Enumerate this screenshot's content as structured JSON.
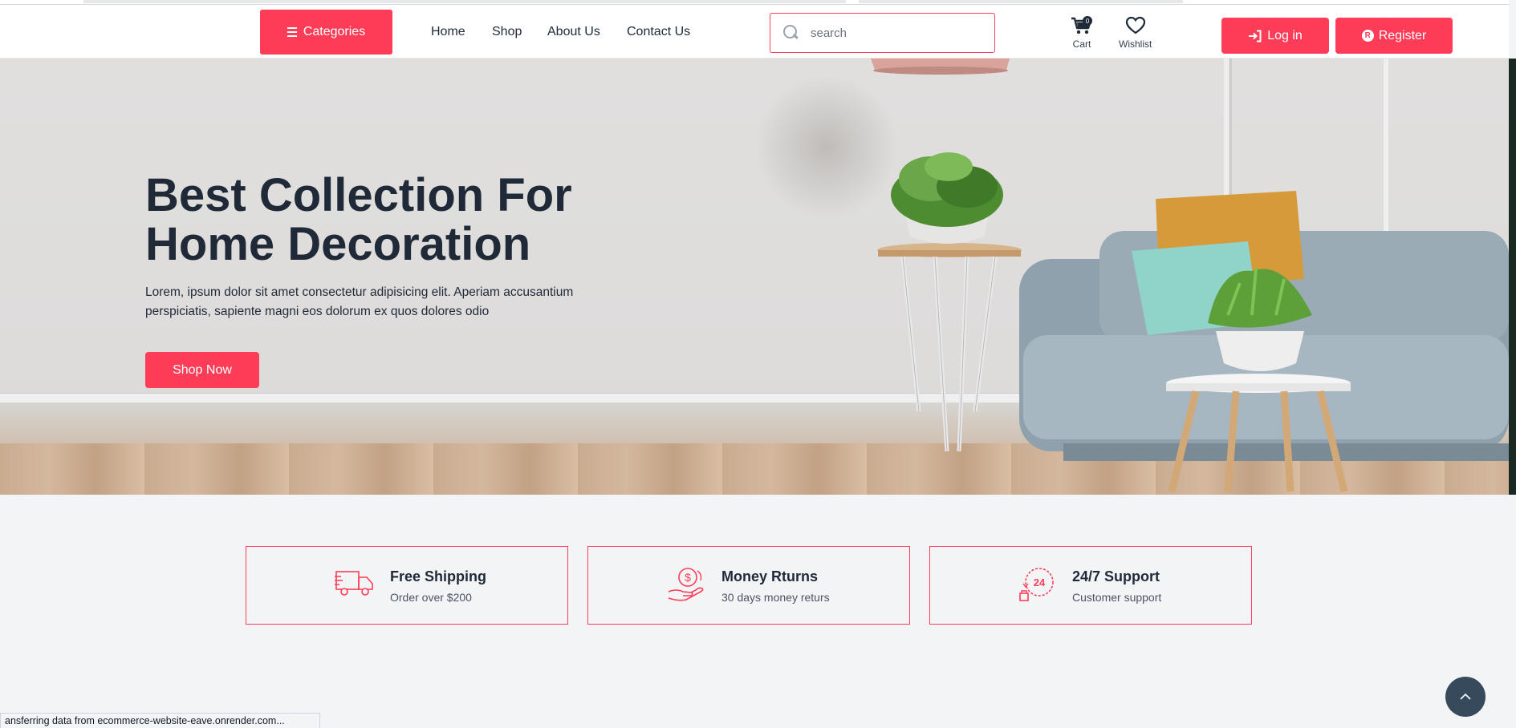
{
  "header": {
    "categories_label": "Categories",
    "nav": [
      "Home",
      "Shop",
      "About Us",
      "Contact Us"
    ],
    "search_placeholder": "search",
    "cart_label": "Cart",
    "cart_count": "0",
    "wishlist_label": "Wishlist",
    "login_label": "Log in",
    "register_label": "Register",
    "register_icon_letter": "R"
  },
  "hero": {
    "title_line1": "Best Collection For",
    "title_line2": "Home Decoration",
    "text": "Lorem, ipsum dolor sit amet consectetur adipisicing elit. Aperiam accusantium perspiciatis, sapiente magni eos dolorum ex quos dolores odio",
    "cta_label": "Shop Now"
  },
  "features": [
    {
      "title": "Free Shipping",
      "subtitle": "Order over $200",
      "icon": "delivery-truck-icon"
    },
    {
      "title": "Money Rturns",
      "subtitle": "30 days money returs",
      "icon": "money-hand-icon"
    },
    {
      "title": "24/7 Support",
      "subtitle": "Customer support",
      "icon": "support-24-icon"
    }
  ],
  "status_bar": "ansferring data from ecommerce-website-eave.onrender.com...",
  "colors": {
    "primary": "#fd3d57",
    "heading": "#1f2937",
    "page_bg": "#f3f4f6",
    "scroll_top_bg": "#374a5c"
  }
}
